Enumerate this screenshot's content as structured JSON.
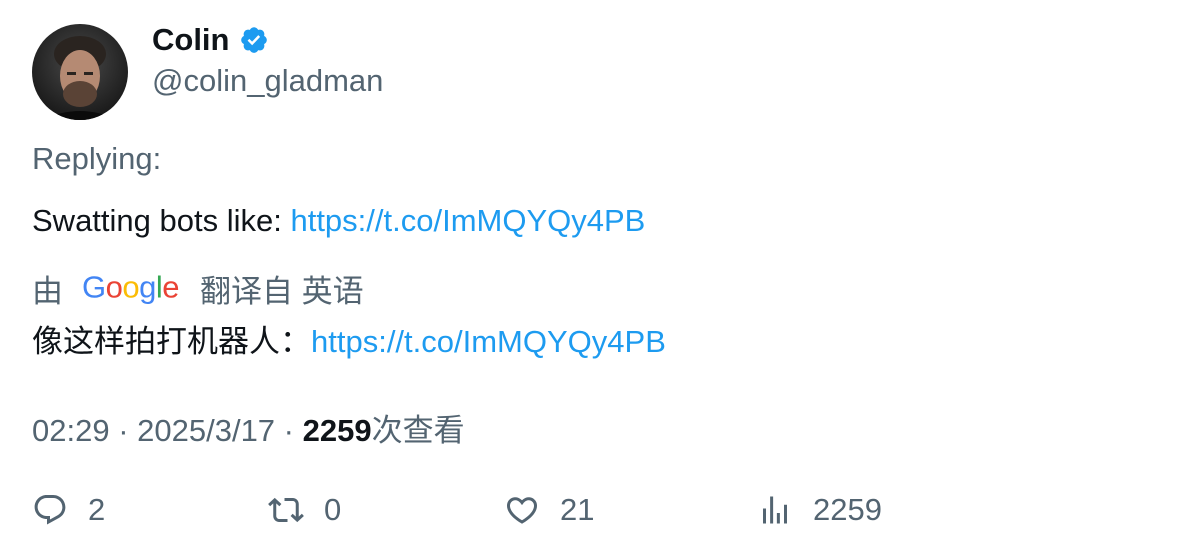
{
  "author": {
    "name": "Colin",
    "handle": "@colin_gladman",
    "verified_color": "#1d9bf0"
  },
  "tweet": {
    "replying_label": "Replying:",
    "text": "Swatting bots like: ",
    "link": "https://t.co/ImMQYQy4PB",
    "link_color": "#1d9bf0"
  },
  "translation": {
    "prefix": "由",
    "provider_logo": "Google",
    "suffix": "翻译自 英语",
    "text": "像这样拍打机器人：",
    "link": "https://t.co/ImMQYQy4PB"
  },
  "meta": {
    "time": "02:29",
    "separator": " · ",
    "date": "2025/3/17",
    "views": "2259",
    "views_label": "次查看"
  },
  "actions": {
    "replies": {
      "icon": "reply-icon",
      "count": "2"
    },
    "retweets": {
      "icon": "retweet-icon",
      "count": "0"
    },
    "likes": {
      "icon": "heart-icon",
      "count": "21"
    },
    "views": {
      "icon": "analytics-icon",
      "count": "2259"
    }
  }
}
